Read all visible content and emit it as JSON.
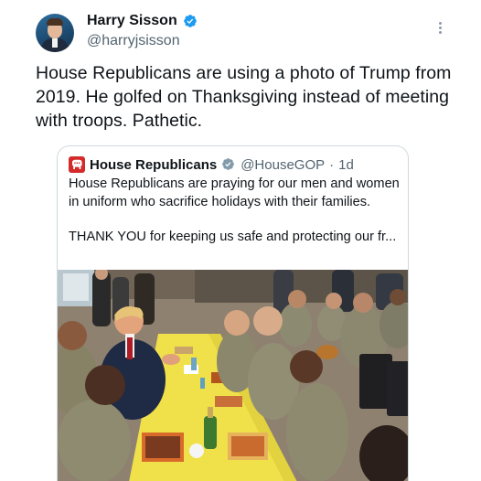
{
  "author": {
    "display_name": "Harry Sisson",
    "handle": "@harryjsisson"
  },
  "tweet": {
    "text": "House Republicans are using a photo of Trump from 2019. He golfed on Thanksgiving instead of meeting with troops. Pathetic."
  },
  "quoted_tweet": {
    "display_name": "House Republicans",
    "handle": "@HouseGOP",
    "separator": "·",
    "time": "1d",
    "text_line1": "House Republicans are praying for our men and women in uniform who sacrifice holidays with their families.",
    "text_line2": "THANK YOU for keeping us safe and protecting our fr..."
  },
  "icons": {
    "verified": "verified-badge-icon",
    "more": "more-options-icon",
    "quote_logo": "gop-elephant-logo"
  },
  "colors": {
    "verified_blue": "#1d9bf0",
    "secondary_text": "#536471",
    "gop_red": "#d42a2a",
    "border": "#cfd9de",
    "table_yellow": "#f2e34a"
  }
}
